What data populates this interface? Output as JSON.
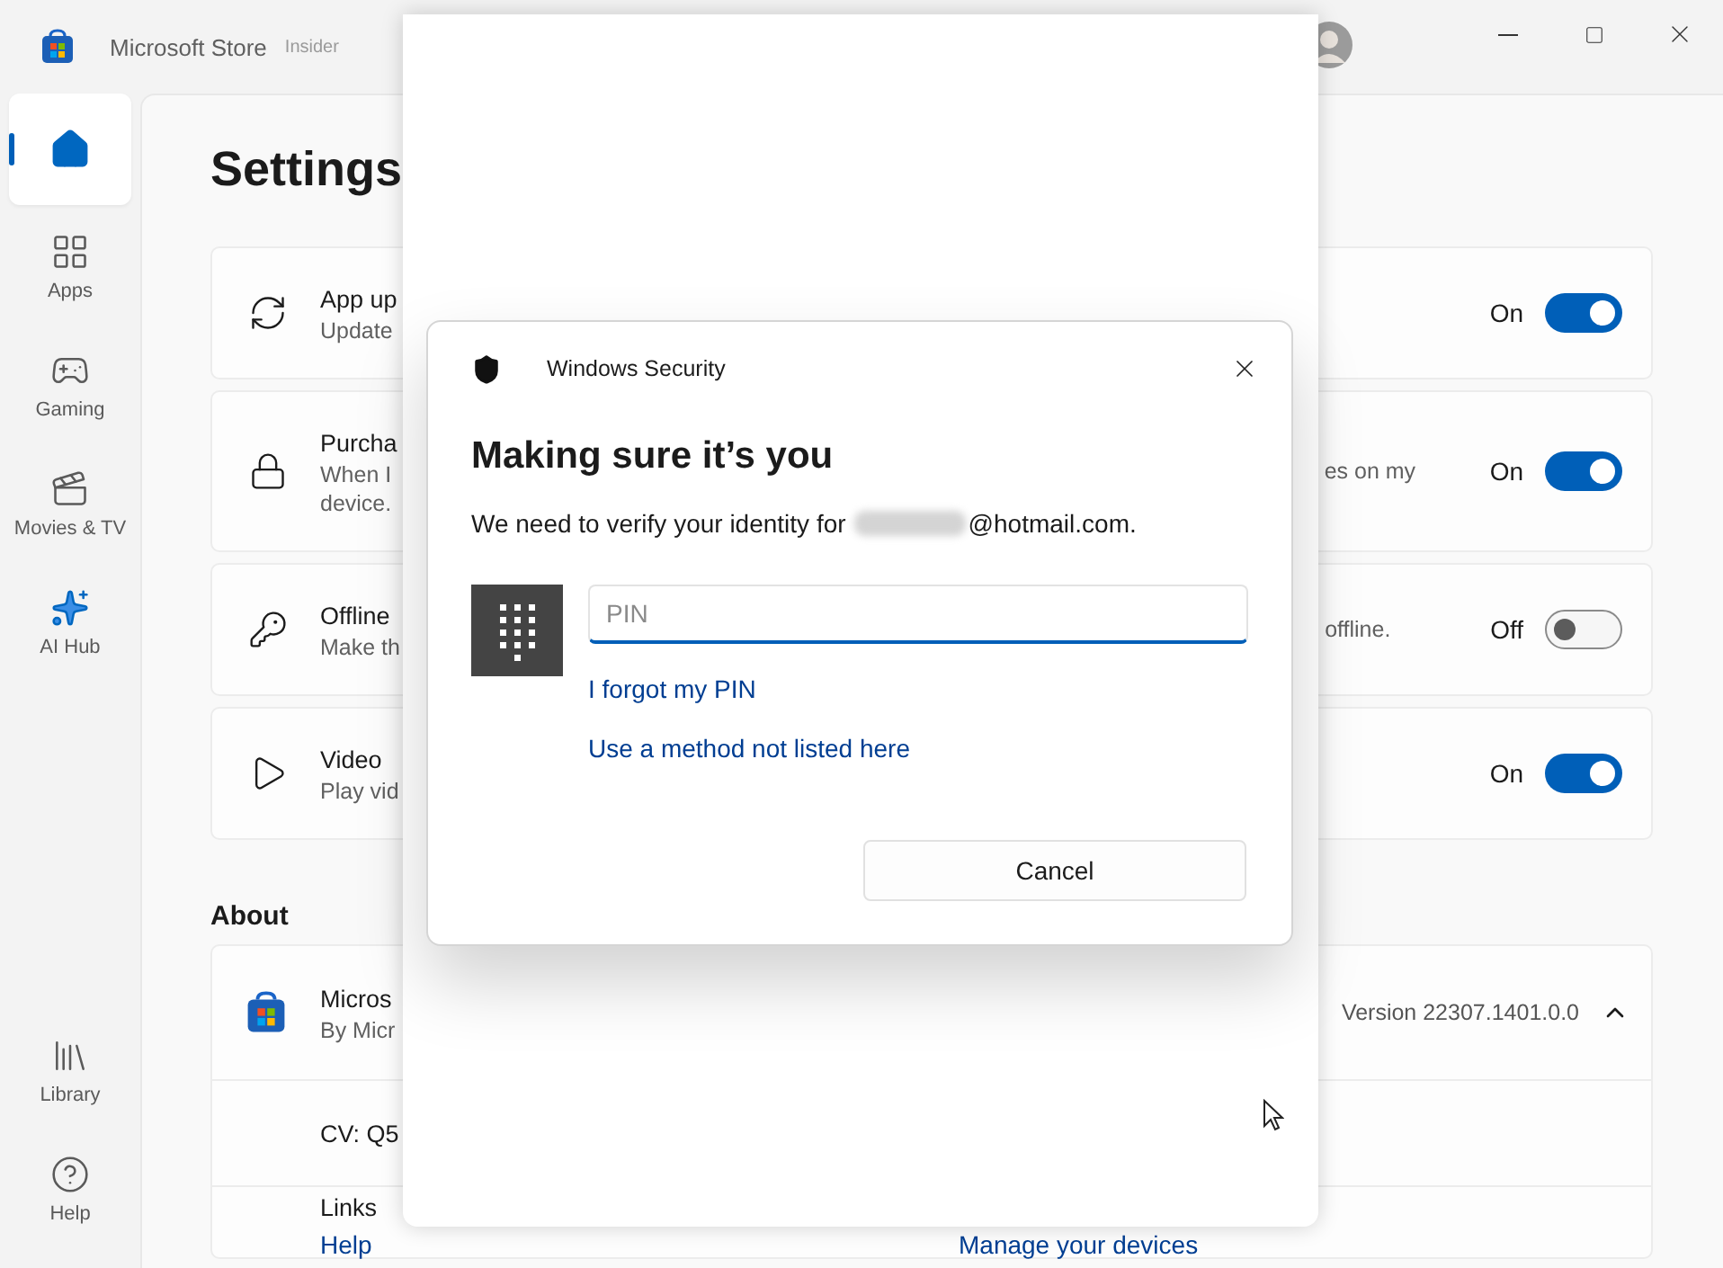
{
  "window": {
    "title": "Microsoft Store",
    "badge": "Insider"
  },
  "sidebar": {
    "items": [
      {
        "kind": "home",
        "selected": true
      },
      {
        "kind": "apps",
        "label": "Apps",
        "selected": false
      },
      {
        "kind": "gaming",
        "label": "Gaming",
        "selected": false
      },
      {
        "kind": "movies",
        "label": "Movies & TV",
        "selected": false
      },
      {
        "kind": "ai",
        "label": "AI Hub",
        "selected": false
      }
    ],
    "bottom_items": [
      {
        "kind": "library",
        "label": "Library",
        "selected": false
      },
      {
        "kind": "help",
        "label": "Help",
        "selected": false
      }
    ]
  },
  "page_title": "Settings",
  "settings": [
    {
      "kind": "update",
      "title": "App up",
      "description": [
        "Update"
      ],
      "status": "On",
      "on": true
    },
    {
      "kind": "lock",
      "title": "Purcha",
      "description": [
        "When I",
        "device."
      ],
      "description_end": "es on my",
      "status": "On",
      "on": true
    },
    {
      "kind": "key",
      "title": "Offline",
      "description": [
        "Make th"
      ],
      "description_end": "offline.",
      "status": "Off",
      "on": false
    },
    {
      "kind": "play",
      "title": "Video",
      "description": [
        "Play vid"
      ],
      "status": "On",
      "on": true
    }
  ],
  "about": {
    "heading": "About",
    "app_name": "Micros",
    "publisher": "By Micr",
    "version": "Version 22307.1401.0.0",
    "expanded": true,
    "cv": "CV: Q5",
    "links_heading": "Links",
    "links": [
      "Help",
      "Manage your devices"
    ]
  },
  "dialog": {
    "app": "Windows Security",
    "title": "Making sure it’s you",
    "message": "We need to verify your identity for",
    "email_domain": "@hotmail.com.",
    "pin_placeholder": "PIN",
    "links": [
      "I forgot my PIN",
      "Use a method not listed here"
    ],
    "cancel": "Cancel"
  }
}
